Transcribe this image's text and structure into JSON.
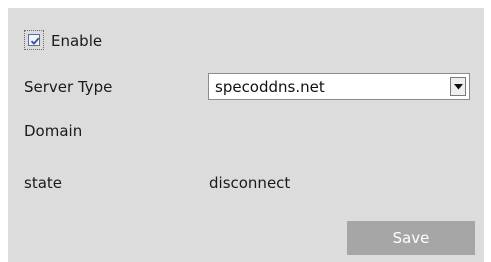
{
  "enable": {
    "label": "Enable",
    "checked": true
  },
  "fields": {
    "server_type": {
      "label": "Server Type",
      "selected_value": "specoddns.net"
    },
    "domain": {
      "label": "Domain",
      "value": ""
    },
    "state": {
      "label": "state",
      "value": "disconnect"
    }
  },
  "actions": {
    "save_label": "Save"
  },
  "colors": {
    "panel_background": "#dcdcdc",
    "save_button_background": "#a6a6a6",
    "save_button_text": "#ffffff"
  },
  "icons": {
    "checkbox": "checkmark-icon",
    "dropdown": "chevron-down-icon"
  }
}
